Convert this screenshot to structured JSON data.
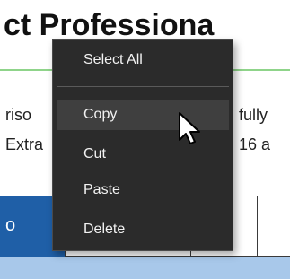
{
  "document": {
    "title_fragment": "ct Professiona",
    "line1_left": "riso",
    "line1_right": "fully",
    "line2_left": "Extra",
    "line2_right": "16 a",
    "table_header_fragment": "o"
  },
  "context_menu": {
    "items": [
      {
        "label": "Select All"
      },
      {
        "label": "Copy"
      },
      {
        "label": "Cut"
      },
      {
        "label": "Paste"
      },
      {
        "label": "Delete"
      }
    ],
    "highlighted": "Copy"
  },
  "colors": {
    "title_rule": "#8fd48a",
    "menu_background": "#2b2b2b",
    "menu_hover": "#3f3f3f",
    "table_header": "#1f5fa7",
    "table_band": "#a8c8ea"
  },
  "icons": {
    "pointer": "mouse-pointer-icon"
  }
}
